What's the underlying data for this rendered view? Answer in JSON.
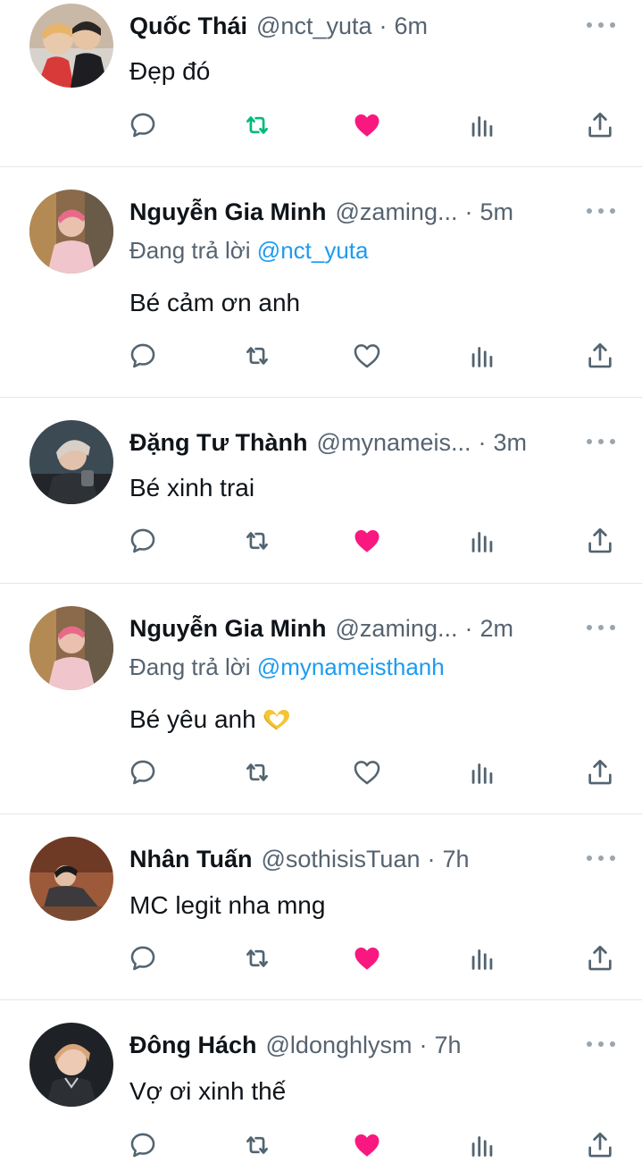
{
  "colors": {
    "like_active": "#f91880",
    "retweet_active": "#00ba7c",
    "icon_default": "#536471",
    "mention": "#1d9bf0"
  },
  "icons": {
    "reply": "reply-icon",
    "retweet": "retweet-icon",
    "like": "heart-icon",
    "stats": "stats-icon",
    "share": "share-icon",
    "more": "more-icon"
  },
  "tweets": [
    {
      "name": "Quốc Thái",
      "handle": "@nct_yuta",
      "dot": "·",
      "time": "6m",
      "text": "Đẹp đó",
      "liked": true,
      "retweeted": true
    },
    {
      "name": "Nguyễn Gia Minh",
      "handle": "@zaming...",
      "dot": "·",
      "time": "5m",
      "replying_prefix": "Đang trả lời",
      "replying_to": "@nct_yuta",
      "text": "Bé cảm ơn anh",
      "liked": false,
      "retweeted": false
    },
    {
      "name": "Đặng Tư Thành",
      "handle": "@mynameis...",
      "dot": "·",
      "time": "3m",
      "text": "Bé xinh trai",
      "liked": true,
      "retweeted": false
    },
    {
      "name": "Nguyễn Gia Minh",
      "handle": "@zaming...",
      "dot": "·",
      "time": "2m",
      "replying_prefix": "Đang trả lời",
      "replying_to": "@mynameisthanh",
      "text": "Bé yêu anh",
      "liked": false,
      "retweeted": false
    },
    {
      "name": "Nhân Tuấn",
      "handle": "@sothisisTuan",
      "dot": "·",
      "time": "7h",
      "text": "MC legit nha mng",
      "liked": true,
      "retweeted": false
    },
    {
      "name": "Đông Hách",
      "handle": "@ldonghlysm",
      "dot": "·",
      "time": "7h",
      "text": "Vợ ơi xinh thế",
      "liked": true,
      "retweeted": false
    }
  ]
}
